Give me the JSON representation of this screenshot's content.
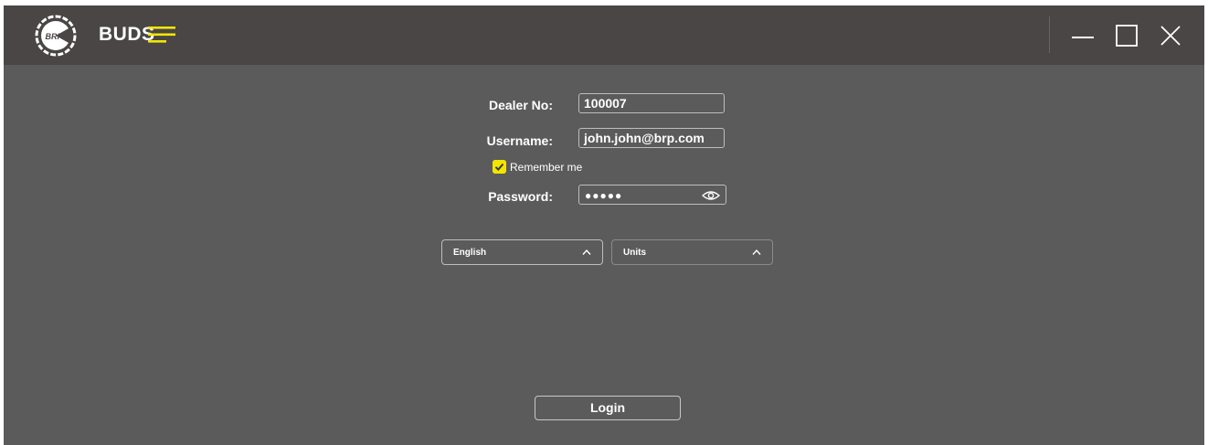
{
  "window": {
    "app_name": "BUDS",
    "logo_text": "BRP",
    "accent_color": "#f2e600",
    "titlebar_color": "#4a4646",
    "body_color": "#5b5b5b"
  },
  "titlebar": {
    "menu_icon": "hamburger-menu-icon",
    "minimize_icon": "minimize-icon",
    "maximize_icon": "maximize-icon",
    "close_icon": "close-icon"
  },
  "form": {
    "dealer_label": "Dealer No:",
    "dealer_value": "100007",
    "username_label": "Username:",
    "username_value": "john.john@brp.com",
    "remember_label": "Remember me",
    "remember_checked": true,
    "password_label": "Password:",
    "password_mask": "●●●●●",
    "password_toggle_icon": "eye-icon"
  },
  "selects": {
    "language_value": "English",
    "units_value": "Units",
    "chevron_icon": "chevron-up-icon"
  },
  "actions": {
    "login_label": "Login"
  }
}
